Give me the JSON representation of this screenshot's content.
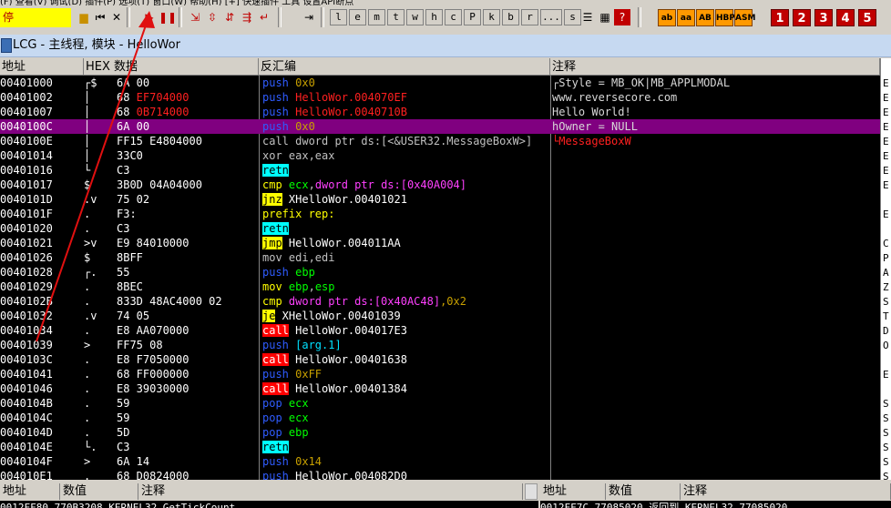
{
  "toolbar": {
    "status_label": "停",
    "menu_fragment": "(F)  查看(V)  调试(D)  插件(P)  选项(T)  窗口(W)  帮助(H)  [+]  快速插件  工具  设置API断点",
    "letter_buttons": [
      "l",
      "e",
      "m",
      "t",
      "w",
      "h",
      "c",
      "P",
      "k",
      "b",
      "r",
      "...",
      "s"
    ],
    "accent_buttons": [
      "ab",
      "aa",
      "AB",
      "HBP",
      "ASM"
    ],
    "number_buttons": [
      "1",
      "2",
      "3",
      "4",
      "5"
    ],
    "icons": [
      "open-icon",
      "restart-icon",
      "close-icon",
      "run-icon",
      "pause-icon",
      "step-into-icon",
      "step-over-icon",
      "trace-into-icon",
      "trace-over-icon",
      "execute-till-return-icon",
      "goto-icon",
      "list-icon",
      "grid-icon",
      "help-icon"
    ]
  },
  "window": {
    "title": "LCG - 主线程, 模块 - HelloWor"
  },
  "columns": {
    "address": "地址",
    "hex": "HEX 数据",
    "disasm": "反汇编",
    "comment": "注释",
    "registers": "寄"
  },
  "colors": {
    "push": "#0000ff",
    "call_bg": "#ff0000",
    "jmp_bg": "#ffff00",
    "retn_bg": "#00ffff",
    "selected": "#800080",
    "arrow": "#e01010"
  },
  "rows": [
    {
      "addr": "00401000",
      "flag": "┌$",
      "hex": "6A 00",
      "dis": [
        {
          "t": "push",
          "c": "push"
        },
        {
          "t": " 0x0",
          "c": "imm"
        }
      ],
      "cmt": "┌Style = MB_OK|MB_APPLMODAL"
    },
    {
      "addr": "00401002",
      "flag": "│",
      "hex": "68 EF704000",
      "dis": [
        {
          "t": "push",
          "c": "push"
        },
        {
          "t": " HelloWor.004070EF",
          "c": "red"
        }
      ],
      "cmt": " www.reversecore.com"
    },
    {
      "addr": "00401007",
      "flag": "│",
      "hex": "68 0B714000",
      "dis": [
        {
          "t": "push",
          "c": "push"
        },
        {
          "t": " HelloWor.0040710B",
          "c": "red"
        }
      ],
      "cmt": " Hello World!"
    },
    {
      "addr": "0040100C",
      "flag": "│",
      "hex": "6A 00",
      "dis": [
        {
          "t": "push",
          "c": "push"
        },
        {
          "t": " 0x0",
          "c": "imm"
        }
      ],
      "cmt": " hOwner = NULL",
      "sel": true
    },
    {
      "addr": "0040100E",
      "flag": "│",
      "hex": "FF15 E4804000",
      "dis": [
        {
          "t": "call dword ptr ds:[<&USER32.MessageBoxW>]",
          "c": "plain"
        }
      ],
      "cmt": "└MessageBoxW",
      "cmt_red": true
    },
    {
      "addr": "00401014",
      "flag": "│",
      "hex": "33C0",
      "dis": [
        {
          "t": "xor eax,eax",
          "c": "plain"
        }
      ],
      "cmt": ""
    },
    {
      "addr": "00401016",
      "flag": "└",
      "hex": "C3",
      "dis": [
        {
          "t": "retn",
          "c": "retn"
        }
      ],
      "cmt": ""
    },
    {
      "addr": "00401017",
      "flag": "$",
      "hex": "3B0D 04A04000",
      "dis": [
        {
          "t": "cmp",
          "c": "yellow"
        },
        {
          "t": " ecx",
          "c": "green"
        },
        {
          "t": ",",
          "c": "plain"
        },
        {
          "t": "dword ptr ds:[0x40A004]",
          "c": "magenta"
        }
      ],
      "cmt": ""
    },
    {
      "addr": "0040101D",
      "flag": ".v",
      "hex": "75 02",
      "dis": [
        {
          "t": "jnz",
          "c": "jmp"
        },
        {
          "t": " XHelloWor.00401021",
          "c": "white"
        }
      ],
      "cmt": ""
    },
    {
      "addr": "0040101F",
      "flag": ".",
      "hex": "F3:",
      "dis": [
        {
          "t": "prefix rep:",
          "c": "yellow"
        }
      ],
      "cmt": ""
    },
    {
      "addr": "00401020",
      "flag": ".",
      "hex": "C3",
      "dis": [
        {
          "t": "retn",
          "c": "retn"
        }
      ],
      "cmt": ""
    },
    {
      "addr": "00401021",
      "flag": ">v",
      "hex": "E9 84010000",
      "dis": [
        {
          "t": "jmp",
          "c": "jmp"
        },
        {
          "t": " HelloWor.004011AA",
          "c": "white"
        }
      ],
      "cmt": ""
    },
    {
      "addr": "00401026",
      "flag": "$",
      "hex": "8BFF",
      "dis": [
        {
          "t": "mov edi,edi",
          "c": "plain"
        }
      ],
      "cmt": ""
    },
    {
      "addr": "00401028",
      "flag": "┌.",
      "hex": "55",
      "dis": [
        {
          "t": "push",
          "c": "push"
        },
        {
          "t": " ebp",
          "c": "green"
        }
      ],
      "cmt": ""
    },
    {
      "addr": "00401029",
      "flag": ".",
      "hex": "8BEC",
      "dis": [
        {
          "t": "mov",
          "c": "yellow"
        },
        {
          "t": " ebp",
          "c": "green"
        },
        {
          "t": ",",
          "c": "plain"
        },
        {
          "t": "esp",
          "c": "green"
        }
      ],
      "cmt": ""
    },
    {
      "addr": "0040102B",
      "flag": ".",
      "hex": "833D 48AC4000 02",
      "dis": [
        {
          "t": "cmp",
          "c": "yellow"
        },
        {
          "t": " dword ptr ds:[0x40AC48]",
          "c": "magenta"
        },
        {
          "t": ",0x2",
          "c": "imm"
        }
      ],
      "cmt": ""
    },
    {
      "addr": "00401032",
      "flag": ".v",
      "hex": "74 05",
      "dis": [
        {
          "t": "je",
          "c": "jmp"
        },
        {
          "t": " XHelloWor.00401039",
          "c": "white"
        }
      ],
      "cmt": ""
    },
    {
      "addr": "00401034",
      "flag": ".",
      "hex": "E8 AA070000",
      "dis": [
        {
          "t": "call",
          "c": "call"
        },
        {
          "t": " HelloWor.004017E3",
          "c": "white"
        }
      ],
      "cmt": ""
    },
    {
      "addr": "00401039",
      "flag": ">",
      "hex": "FF75 08",
      "dis": [
        {
          "t": "push",
          "c": "push"
        },
        {
          "t": " [arg.1]",
          "c": "cyan"
        }
      ],
      "cmt": ""
    },
    {
      "addr": "0040103C",
      "flag": ".",
      "hex": "E8 F7050000",
      "dis": [
        {
          "t": "call",
          "c": "call"
        },
        {
          "t": " HelloWor.00401638",
          "c": "white"
        }
      ],
      "cmt": ""
    },
    {
      "addr": "00401041",
      "flag": ".",
      "hex": "68 FF000000",
      "dis": [
        {
          "t": "push",
          "c": "push"
        },
        {
          "t": " 0xFF",
          "c": "imm"
        }
      ],
      "cmt": ""
    },
    {
      "addr": "00401046",
      "flag": ".",
      "hex": "E8 39030000",
      "dis": [
        {
          "t": "call",
          "c": "call"
        },
        {
          "t": " HelloWor.00401384",
          "c": "white"
        }
      ],
      "cmt": ""
    },
    {
      "addr": "0040104B",
      "flag": ".",
      "hex": "59",
      "dis": [
        {
          "t": "pop",
          "c": "push"
        },
        {
          "t": " ecx",
          "c": "green"
        }
      ],
      "cmt": ""
    },
    {
      "addr": "0040104C",
      "flag": ".",
      "hex": "59",
      "dis": [
        {
          "t": "pop",
          "c": "push"
        },
        {
          "t": " ecx",
          "c": "green"
        }
      ],
      "cmt": ""
    },
    {
      "addr": "0040104D",
      "flag": ".",
      "hex": "5D",
      "dis": [
        {
          "t": "pop",
          "c": "push"
        },
        {
          "t": " ebp",
          "c": "green"
        }
      ],
      "cmt": ""
    },
    {
      "addr": "0040104E",
      "flag": "└.",
      "hex": "C3",
      "dis": [
        {
          "t": "retn",
          "c": "retn"
        }
      ],
      "cmt": ""
    },
    {
      "addr": "0040104F",
      "flag": ">",
      "hex": "6A 14",
      "dis": [
        {
          "t": "push",
          "c": "push"
        },
        {
          "t": " 0x14",
          "c": "imm"
        }
      ],
      "cmt": ""
    },
    {
      "addr": "004010E1",
      "flag": ".",
      "hex": "68 D0824000",
      "dis": [
        {
          "t": "push",
          "c": "push"
        },
        {
          "t": " HelloWor.004082D0",
          "c": "white"
        }
      ],
      "cmt": ""
    }
  ],
  "registers": [
    "E",
    "E",
    "E",
    "E",
    "E",
    "E",
    "E",
    "E",
    "",
    "E",
    "",
    "C",
    "P",
    "A",
    "Z",
    "S",
    "T",
    "D",
    "O",
    "",
    "E",
    "",
    "S",
    "S",
    "S",
    "S",
    "S",
    "S",
    "S",
    "S"
  ],
  "bottom_left": {
    "headers": [
      "地址",
      "数值",
      "注释"
    ],
    "row": "0012FF80  770B3208  KERNEL32.GetTickCount"
  },
  "bottom_right": {
    "headers": [
      "地址",
      "数值",
      "注释"
    ],
    "row": "0012FF7C  77085020  返回到 KERNEL32.77085020"
  }
}
